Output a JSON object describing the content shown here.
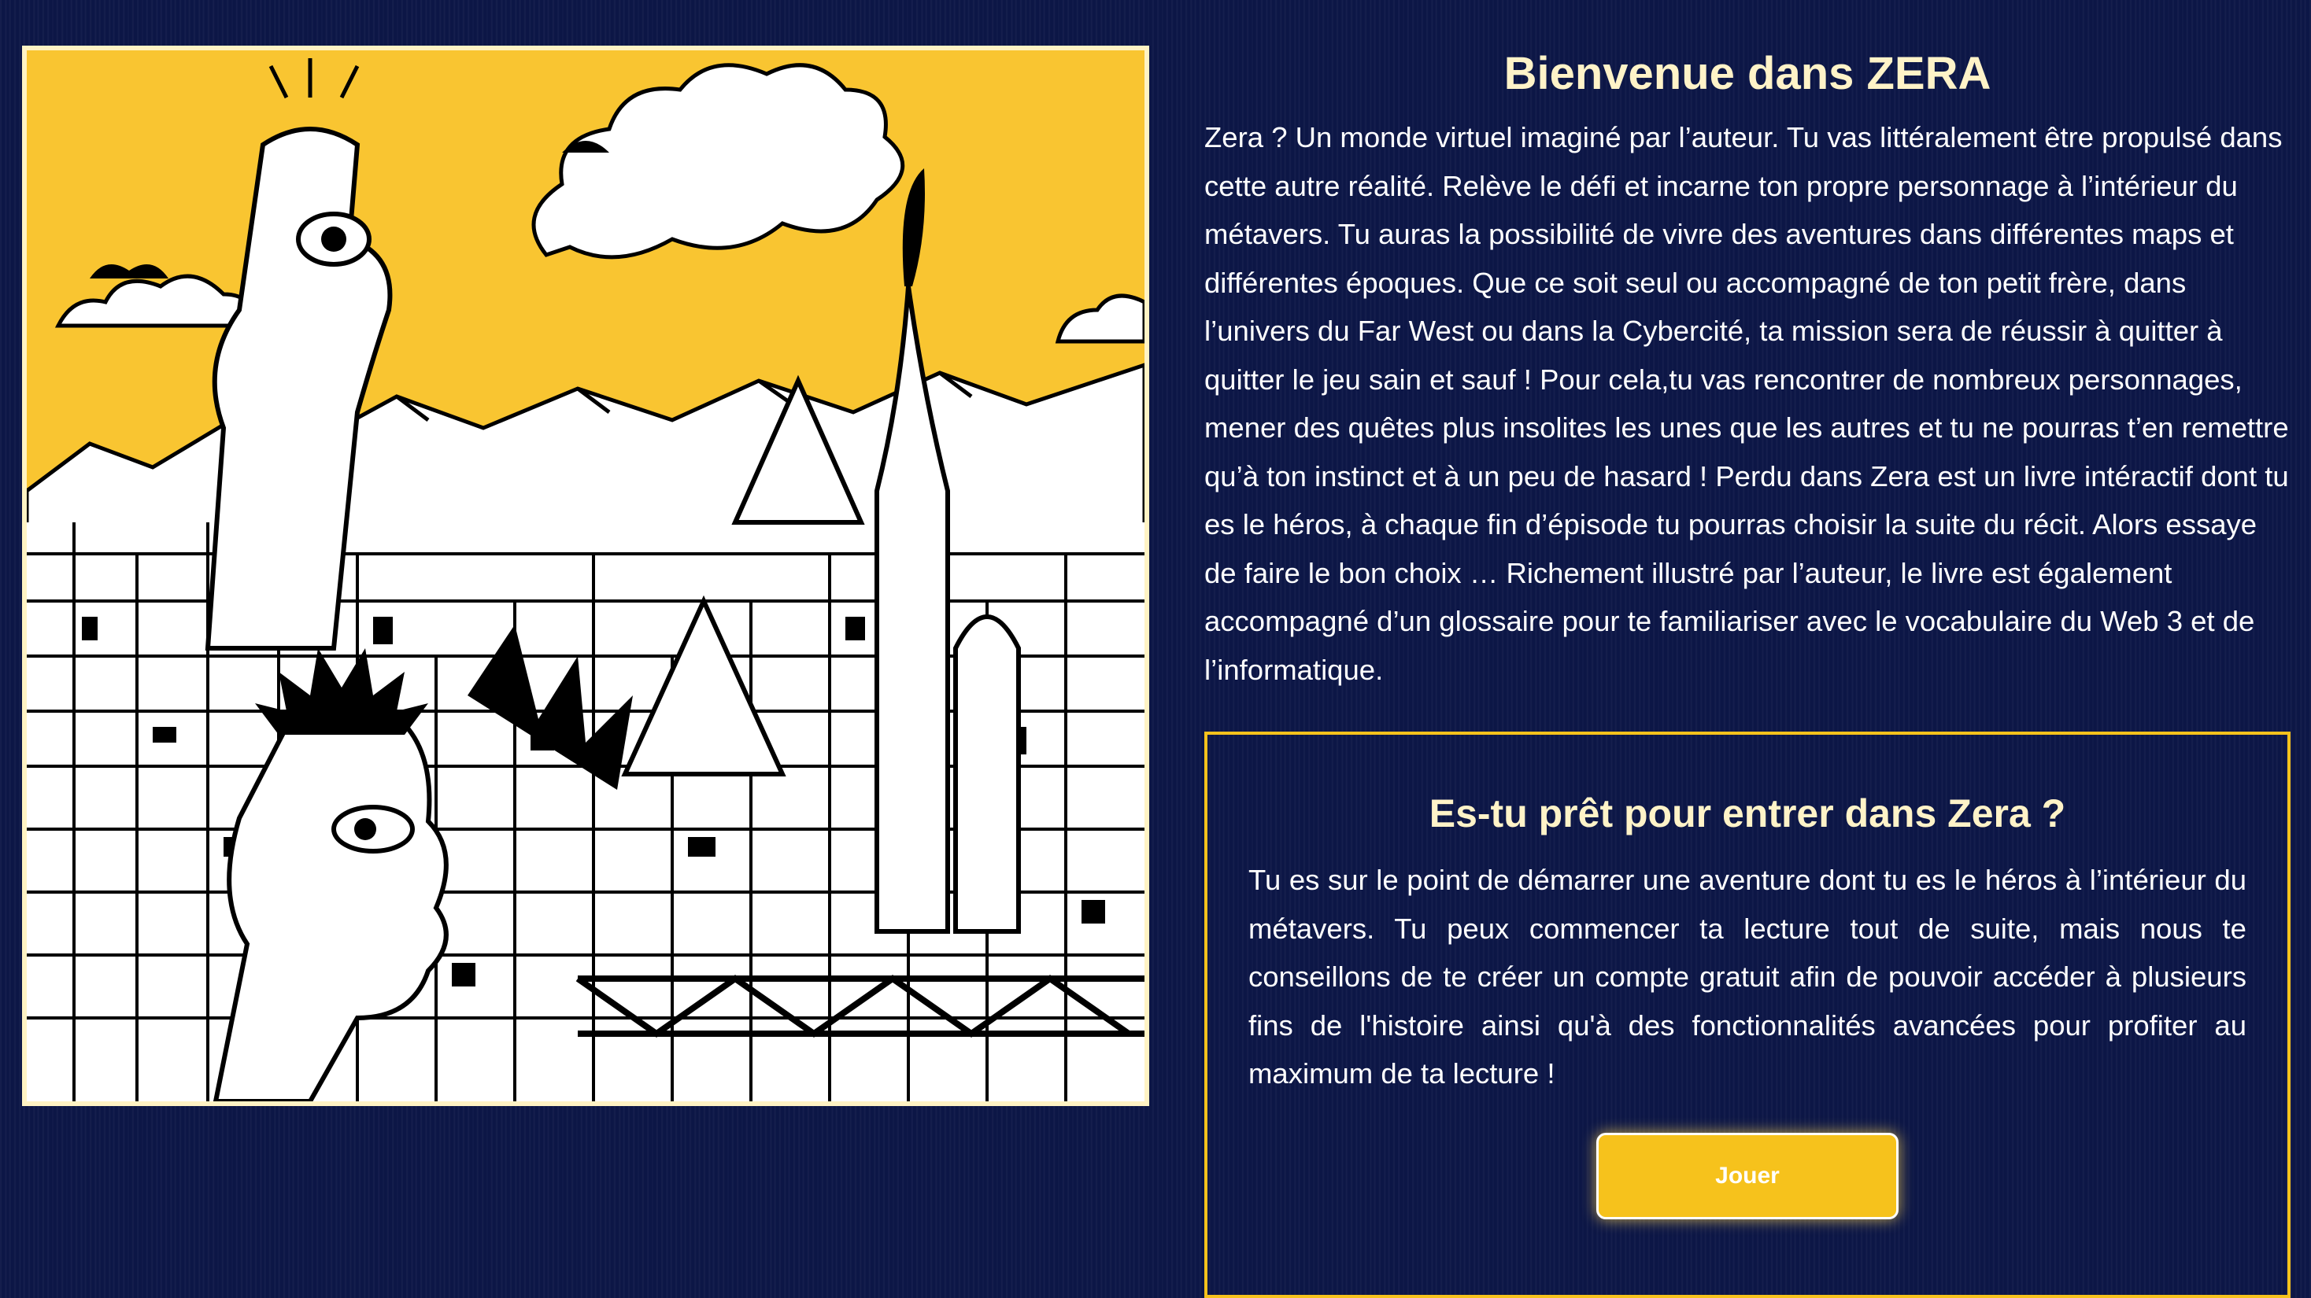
{
  "illustration": {
    "icon": "metaverse-doodle-illustration",
    "sky_color": "#f9c531",
    "frame_color": "#fff3c4"
  },
  "welcome": {
    "title": "Bienvenue dans ZERA",
    "text": "Zera ? Un monde virtuel imaginé par l’auteur. Tu vas littéralement être propulsé dans cette autre réalité. Relève le défi et incarne ton propre personnage à l’intérieur du métavers. Tu auras la possibilité de vivre des aventures dans différentes maps et différentes époques. Que ce soit seul ou accompagné de ton petit frère, dans l’univers du Far West ou dans la Cybercité, ta mission sera de réussir à quitter à quitter le jeu sain et sauf ! Pour cela,tu vas rencontrer de nombreux personnages, mener des quêtes plus insolites les unes que les autres et tu ne pourras t’en remettre qu’à ton instinct et à un peu de hasard ! Perdu dans Zera est un livre intéractif dont tu es le héros, à chaque fin d’épisode tu pourras choisir la suite du récit. Alors essaye de faire le bon choix … Richement illustré par l’auteur, le livre est également accompagné d’un glossaire pour te familiariser avec le vocabulaire du Web 3 et de l’informatique."
  },
  "cta": {
    "title": "Es-tu prêt pour entrer dans Zera ?",
    "text": "Tu es sur le point de démarrer une aventure dont tu es le héros à l’intérieur du métavers. Tu peux commencer ta lecture tout de suite, mais nous te conseillons de te créer un compte gratuit afin de pouvoir accéder à plusieurs fins de l'histoire ainsi qu'à des fonctionnalités avancées pour profiter au maximum de ta lecture !",
    "button_label": "Jouer"
  },
  "colors": {
    "background": "#0c1646",
    "accent": "#f6c21c",
    "title": "#fff3c8"
  }
}
